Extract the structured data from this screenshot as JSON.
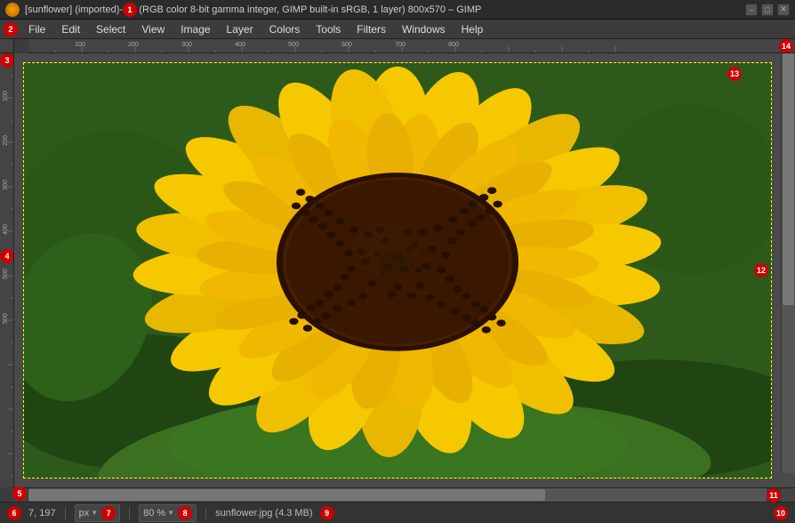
{
  "titlebar": {
    "title": "[sunflower] (imported)-1.0 (RGB color 8-bit gamma integer, GIMP built-in sRGB, 1 layer) 800x570 – GIMP",
    "controls": {
      "minimize": "–",
      "maximize": "□",
      "close": "✕"
    }
  },
  "menubar": {
    "items": [
      {
        "label": "File",
        "id": "file"
      },
      {
        "label": "Edit",
        "id": "edit"
      },
      {
        "label": "Select",
        "id": "select"
      },
      {
        "label": "View",
        "id": "view"
      },
      {
        "label": "Image",
        "id": "image"
      },
      {
        "label": "Layer",
        "id": "layer"
      },
      {
        "label": "Colors",
        "id": "colors"
      },
      {
        "label": "Tools",
        "id": "tools"
      },
      {
        "label": "Filters",
        "id": "filters"
      },
      {
        "label": "Windows",
        "id": "windows"
      },
      {
        "label": "Help",
        "id": "help"
      }
    ]
  },
  "statusbar": {
    "coordinates": "7, 197",
    "unit": "px",
    "zoom": "80 %",
    "filename": "sunflower.jpg (4.3 MB)"
  },
  "badges": [
    {
      "id": 1,
      "label": "1"
    },
    {
      "id": 2,
      "label": "2"
    },
    {
      "id": 3,
      "label": "3"
    },
    {
      "id": 4,
      "label": "4"
    },
    {
      "id": 5,
      "label": "5"
    },
    {
      "id": 6,
      "label": "6"
    },
    {
      "id": 7,
      "label": "7"
    },
    {
      "id": 8,
      "label": "8"
    },
    {
      "id": 9,
      "label": "9"
    },
    {
      "id": 10,
      "label": "10"
    },
    {
      "id": 11,
      "label": "11"
    },
    {
      "id": 12,
      "label": "12"
    },
    {
      "id": 13,
      "label": "13"
    },
    {
      "id": 14,
      "label": "14"
    }
  ]
}
